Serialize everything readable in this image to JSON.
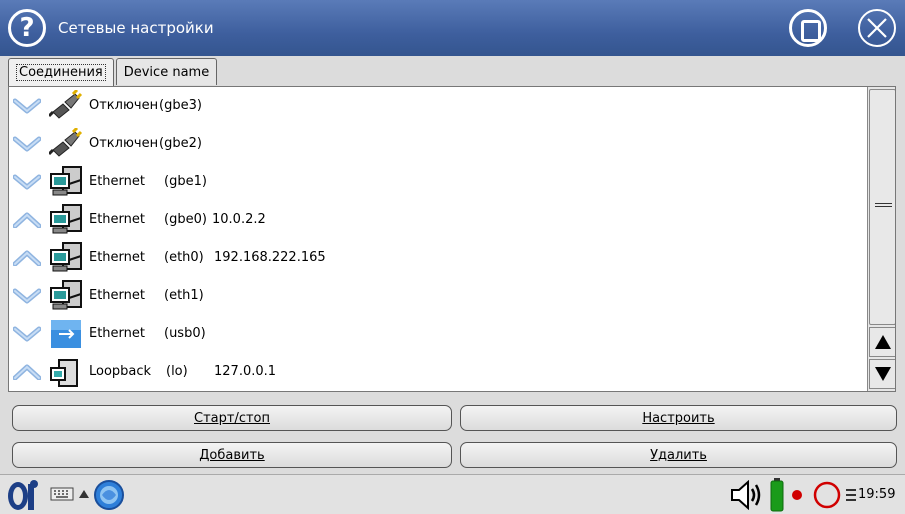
{
  "window": {
    "title": "Сетевые настройки",
    "help_icon": "help-circle-icon",
    "maximize_icon": "maximize-icon",
    "close_icon": "close-circle-icon"
  },
  "tabs": [
    {
      "label": "Соединения",
      "active": true
    },
    {
      "label": "Device name",
      "active": false
    }
  ],
  "connections": [
    {
      "expanded": false,
      "icon": "disconnected-plug-icon",
      "name": "Отключен",
      "iface": "(gbe3)",
      "address": ""
    },
    {
      "expanded": false,
      "icon": "disconnected-plug-icon",
      "name": "Отключен",
      "iface": "(gbe2)",
      "address": ""
    },
    {
      "expanded": false,
      "icon": "network-computer-icon",
      "name": "Ethernet",
      "iface": "(gbe1)",
      "address": ""
    },
    {
      "expanded": true,
      "icon": "network-computer-icon",
      "name": "Ethernet",
      "iface": "(gbe0)",
      "address": "10.0.2.2"
    },
    {
      "expanded": true,
      "icon": "network-computer-icon",
      "name": "Ethernet",
      "iface": "(eth0)",
      "address": "192.168.222.165"
    },
    {
      "expanded": false,
      "icon": "network-computer-icon",
      "name": "Ethernet",
      "iface": "(eth1)",
      "address": ""
    },
    {
      "expanded": false,
      "icon": "usb-network-icon",
      "name": "Ethernet",
      "iface": "(usb0)",
      "address": ""
    },
    {
      "expanded": true,
      "icon": "loopback-computer-icon",
      "name": "Loopback",
      "iface": "(lo)",
      "address": "127.0.0.1"
    }
  ],
  "buttons": {
    "start_stop": "Старт/стоп",
    "configure": "Настроить",
    "add": "Добавить",
    "delete": "Удалить"
  },
  "taskbar": {
    "clock": "19:59",
    "items": [
      "start-menu-icon",
      "keyboard-icon",
      "arrow-up-icon",
      "network-globe-icon",
      "volume-icon",
      "battery-icon",
      "record-indicator-icon",
      "status-circle-icon",
      "network-status-icon"
    ]
  },
  "colors": {
    "titlebar": "#3e5f9e",
    "chevron": "#8fb4e0",
    "battery": "#1a9b1a",
    "record": "#d00000"
  }
}
